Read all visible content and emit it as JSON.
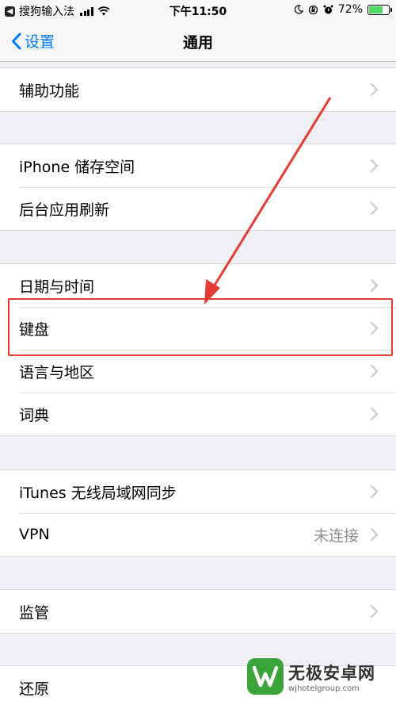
{
  "status_bar": {
    "carrier": "搜狗输入法",
    "time": "下午11:50",
    "battery_percent_label": "72%",
    "battery_level": 0.72
  },
  "nav": {
    "back_label": "设置",
    "title": "通用"
  },
  "groups": [
    {
      "items": [
        {
          "label": "辅助功能"
        }
      ]
    },
    {
      "items": [
        {
          "label": "iPhone 储存空间"
        },
        {
          "label": "后台应用刷新"
        }
      ]
    },
    {
      "items": [
        {
          "label": "日期与时间"
        },
        {
          "label": "键盘"
        },
        {
          "label": "语言与地区"
        },
        {
          "label": "词典"
        }
      ]
    },
    {
      "items": [
        {
          "label": "iTunes 无线局域网同步"
        },
        {
          "label": "VPN",
          "detail": "未连接"
        }
      ]
    },
    {
      "items": [
        {
          "label": "监管"
        }
      ]
    },
    {
      "items": [
        {
          "label": "还原"
        }
      ]
    }
  ],
  "watermark": {
    "name": "无极安卓网",
    "url": "wjhotelgroup.com"
  },
  "colors": {
    "accent": "#007aff",
    "annotation": "#e53b36",
    "battery": "#4cd964"
  }
}
